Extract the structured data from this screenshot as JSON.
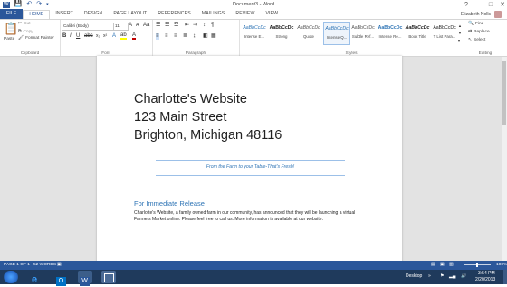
{
  "window": {
    "title": "Document3 - Word",
    "controls": [
      "?",
      "—",
      "□",
      "✕"
    ]
  },
  "tabs": [
    "FILE",
    "HOME",
    "INSERT",
    "DESIGN",
    "PAGE LAYOUT",
    "REFERENCES",
    "MAILINGS",
    "REVIEW",
    "VIEW"
  ],
  "user": {
    "name": "Elizabeth Nolls"
  },
  "ribbon": {
    "clipboard": {
      "label": "Clipboard",
      "paste": "Paste",
      "cut": "Cut",
      "copy": "Copy",
      "format_painter": "Format Painter"
    },
    "font": {
      "label": "Font",
      "family": "Calibri (Body)",
      "size": "11"
    },
    "paragraph": {
      "label": "Paragraph"
    },
    "styles": {
      "label": "Styles",
      "items": [
        {
          "preview": "AaBbCcDc",
          "name": "Intense E..."
        },
        {
          "preview": "AaBbCcDc",
          "name": "Strong"
        },
        {
          "preview": "AaBbCcDc",
          "name": "Quote"
        },
        {
          "preview": "AaBbCcDc",
          "name": "Intense Q..."
        },
        {
          "preview": "AaBbCcDc",
          "name": "Subtle Ref..."
        },
        {
          "preview": "AaBbCcDc",
          "name": "Intense Re..."
        },
        {
          "preview": "AaBbCcDc",
          "name": "Book Title"
        },
        {
          "preview": "AaBbCcDc",
          "name": "T List Para..."
        }
      ]
    },
    "editing": {
      "label": "Editing",
      "find": "Find",
      "replace": "Replace",
      "select": "Select"
    }
  },
  "document": {
    "address": [
      "Charlotte's Website",
      "123 Main Street",
      "Brighton, Michigan 48116"
    ],
    "tagline": "From the Farm to your Table-That's Fresh!",
    "heading": "For Immediate Release",
    "body": "Charlotte's Website, a family owned farm in our community, has announced that they will be launching a virtual Farmers Market online. Please feel free to call us. More information is available at our website."
  },
  "status": {
    "page": "PAGE 1 OF 1",
    "words": "52 WORDS",
    "zoom": "100%"
  },
  "taskbar": {
    "desktop": "Desktop",
    "time": "3:54 PM",
    "date": "2/20/2013"
  },
  "colors": {
    "accent": "#2b579a",
    "heading": "#2e74b5"
  }
}
